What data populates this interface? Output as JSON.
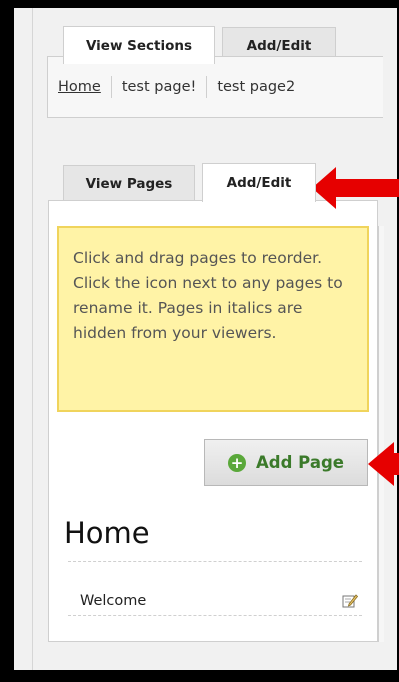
{
  "top_tabs": [
    {
      "label": "View Sections",
      "active": true
    },
    {
      "label": "Add/Edit",
      "active": false
    }
  ],
  "sections": [
    {
      "label": "Home",
      "link": true
    },
    {
      "label": "test page!",
      "link": false
    },
    {
      "label": "test page2",
      "link": false
    }
  ],
  "page_tabs": [
    {
      "label": "View Pages",
      "active": false
    },
    {
      "label": "Add/Edit",
      "active": true
    }
  ],
  "info_note": "Click and drag pages to reorder. Click the icon next to any pages to rename it. Pages in italics are hidden from your viewers.",
  "add_page_button": {
    "label": "Add Page",
    "icon": "plus-circle-icon"
  },
  "section_heading": "Home",
  "pages": [
    {
      "label": "Welcome",
      "icon": "edit-icon"
    }
  ],
  "colors": {
    "arrow": "#e60000",
    "note_bg": "#fff3a6",
    "note_border": "#f0d45c",
    "add_page_text": "#3b7a2a",
    "plus_icon": "#5aa83a"
  }
}
